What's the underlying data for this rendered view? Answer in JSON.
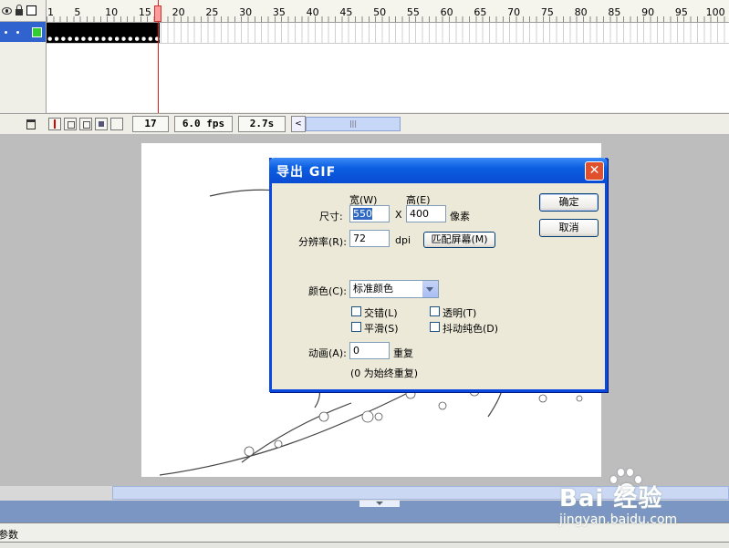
{
  "timeline": {
    "ruler_numbers": [
      "1",
      "5",
      "10",
      "15",
      "20",
      "25",
      "30",
      "35",
      "40",
      "45",
      "50",
      "55",
      "60",
      "65",
      "70",
      "75",
      "80",
      "85",
      "90",
      "95",
      "100"
    ],
    "current_frame": "17",
    "frame_rate": "6.0 fps",
    "elapsed_time": "2.7s",
    "scroll_left": "<",
    "scroll_thumb": "|||"
  },
  "properties_panel": {
    "label": "参数"
  },
  "watermark": {
    "brand": "Bai 经验",
    "url": "jingyan.baidu.com"
  },
  "dialog": {
    "title": "导出 GIF",
    "close": "✕",
    "width_header": "宽(W)",
    "height_header": "高(E)",
    "size_label": "尺寸:",
    "width_value": "550",
    "times": "X",
    "height_value": "400",
    "pixels": "像素",
    "resolution_label": "分辨率(R):",
    "resolution_value": "72",
    "dpi": "dpi",
    "match_screen": "匹配屏幕(M)",
    "ok": "确定",
    "cancel": "取消",
    "colors_label": "颜色(C):",
    "colors_value": "标准颜色",
    "interlace": "交错(L)",
    "transparent": "透明(T)",
    "smooth": "平滑(S)",
    "dither": "抖动纯色(D)",
    "animation_label": "动画(A):",
    "animation_value": "0",
    "repeat": "重复",
    "repeat_note": "(0 为始终重复)"
  },
  "colors": {
    "title_blue": "#0b5ee0",
    "layer_selected": "#3163ce",
    "close_red": "#e0502c",
    "playhead": "#e02020"
  }
}
